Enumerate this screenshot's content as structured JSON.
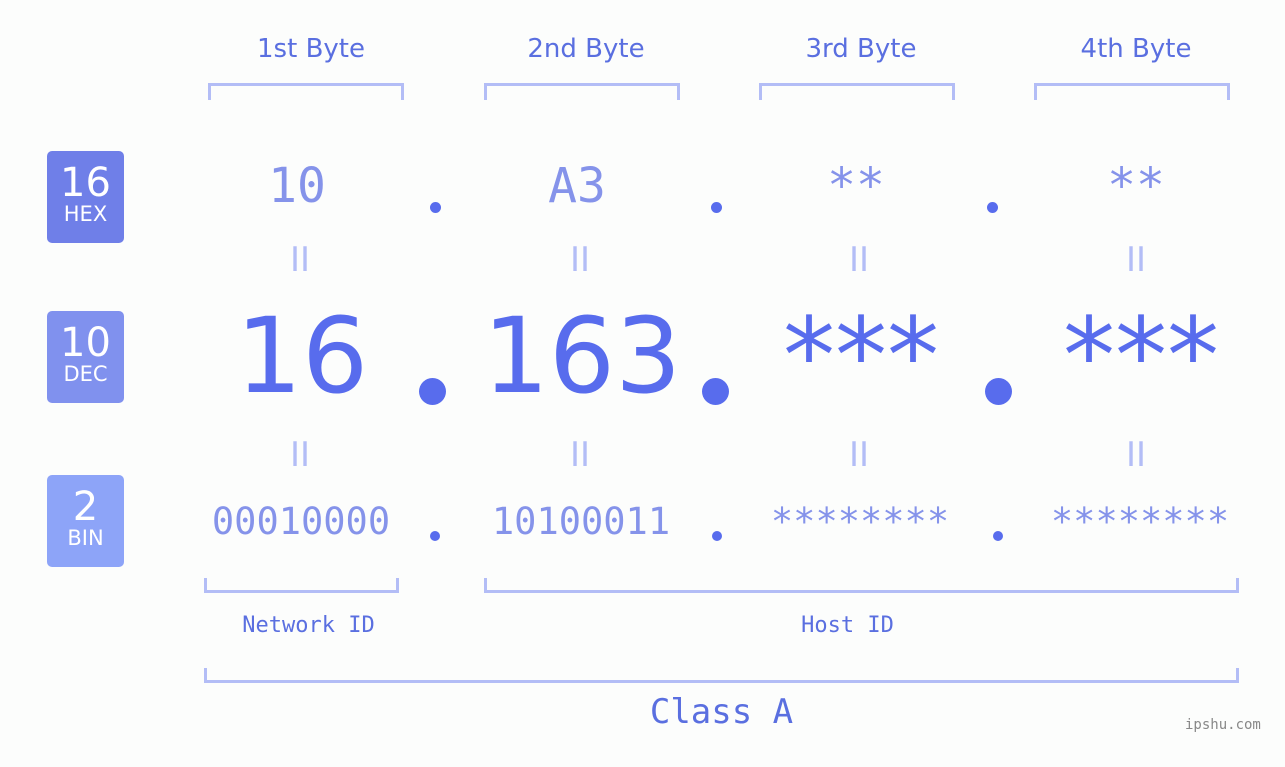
{
  "headers": [
    "1st Byte",
    "2nd Byte",
    "3rd Byte",
    "4th Byte"
  ],
  "badges": [
    {
      "number": "16",
      "label": "HEX",
      "color": "#6f7fe8"
    },
    {
      "number": "10",
      "label": "DEC",
      "color": "#8091ee"
    },
    {
      "number": "2",
      "label": "BIN",
      "color": "#8da4f8"
    }
  ],
  "hex": [
    "10",
    "A3",
    "**",
    "**"
  ],
  "dec": [
    "16",
    "163",
    "***",
    "***"
  ],
  "bin": [
    "00010000",
    "10100011",
    "********",
    "********"
  ],
  "equals": "II",
  "network_id_label": "Network ID",
  "host_id_label": "Host ID",
  "class_label": "Class A",
  "watermark": "ipshu.com"
}
